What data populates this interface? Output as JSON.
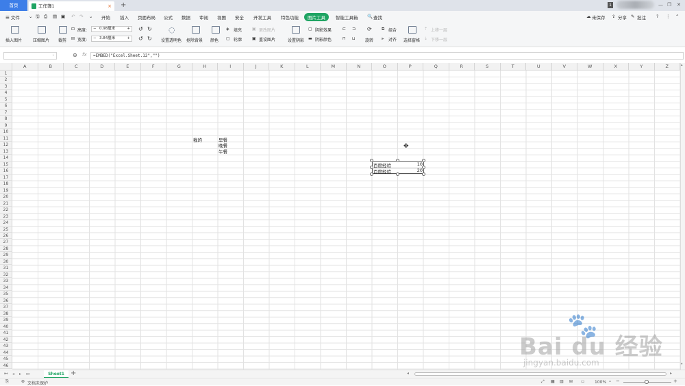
{
  "title_bar": {
    "home_tab": "首页",
    "doc_tab": "工作簿1",
    "doc_close": "×",
    "new_tab": "+",
    "badge": "1"
  },
  "menu": {
    "file": "☰ 文件",
    "items": [
      "开始",
      "插入",
      "页面布局",
      "公式",
      "数据",
      "审阅",
      "视图",
      "安全",
      "开发工具",
      "特色功能",
      "图片工具",
      "智能工具箱"
    ],
    "search": "查找",
    "unsaved": "未保存",
    "share": "分享",
    "comment": "批注"
  },
  "ribbon": {
    "insert_picture": "插入图片",
    "compress_picture": "压缩图片",
    "crop": "裁剪",
    "height_label": "高度:",
    "height_value": "0.98厘米",
    "width_label": "宽度:",
    "width_value": "3.84厘米",
    "set_transparent": "设置透明色",
    "remove_background": "抠除背景",
    "color": "颜色",
    "fill": "填充",
    "outline": "轮廓",
    "change_picture": "更改图片",
    "reset_picture": "重设图片",
    "set_shadow": "设置阴影",
    "shadow_effect": "阴影效果",
    "shadow_color": "阴影颜色",
    "rotate": "旋转",
    "group": "组合",
    "align": "对齐",
    "selection_pane": "选择窗格",
    "bring_forward": "上移一层",
    "send_backward": "下移一层"
  },
  "formula_bar": {
    "name_box": "",
    "fx": "fx",
    "formula": "=EMBED(\"Excel.Sheet.12\",\"\")"
  },
  "columns": [
    "A",
    "B",
    "C",
    "D",
    "E",
    "F",
    "G",
    "H",
    "I",
    "J",
    "K",
    "L",
    "M",
    "N",
    "O",
    "P",
    "Q",
    "R",
    "S",
    "T",
    "U",
    "V",
    "W",
    "X",
    "Y",
    "Z"
  ],
  "rows": [
    "1",
    "2",
    "3",
    "4",
    "5",
    "6",
    "7",
    "8",
    "9",
    "10",
    "11",
    "12",
    "13",
    "14",
    "15",
    "16",
    "17",
    "18",
    "19",
    "20",
    "21",
    "22",
    "23",
    "24",
    "25",
    "26",
    "27",
    "28",
    "29",
    "30",
    "31",
    "32",
    "33",
    "34",
    "35",
    "36",
    "37",
    "38",
    "39",
    "40",
    "41",
    "42",
    "43",
    "44",
    "45",
    "46"
  ],
  "cells": {
    "H11": "我的",
    "I11": "早餐",
    "I12": "晚餐",
    "I13": "午餐"
  },
  "embedded_object": {
    "row1_label": "百度经验",
    "row1_value": "10",
    "row2_label": "百度经验",
    "row2_value": "20"
  },
  "sheet_tabs": [
    "Sheet1"
  ],
  "status": {
    "protect": "文档未保护",
    "zoom": "100%"
  },
  "watermark": {
    "brand": "Bai du 经验",
    "url": "jingyan.baidu.com"
  }
}
